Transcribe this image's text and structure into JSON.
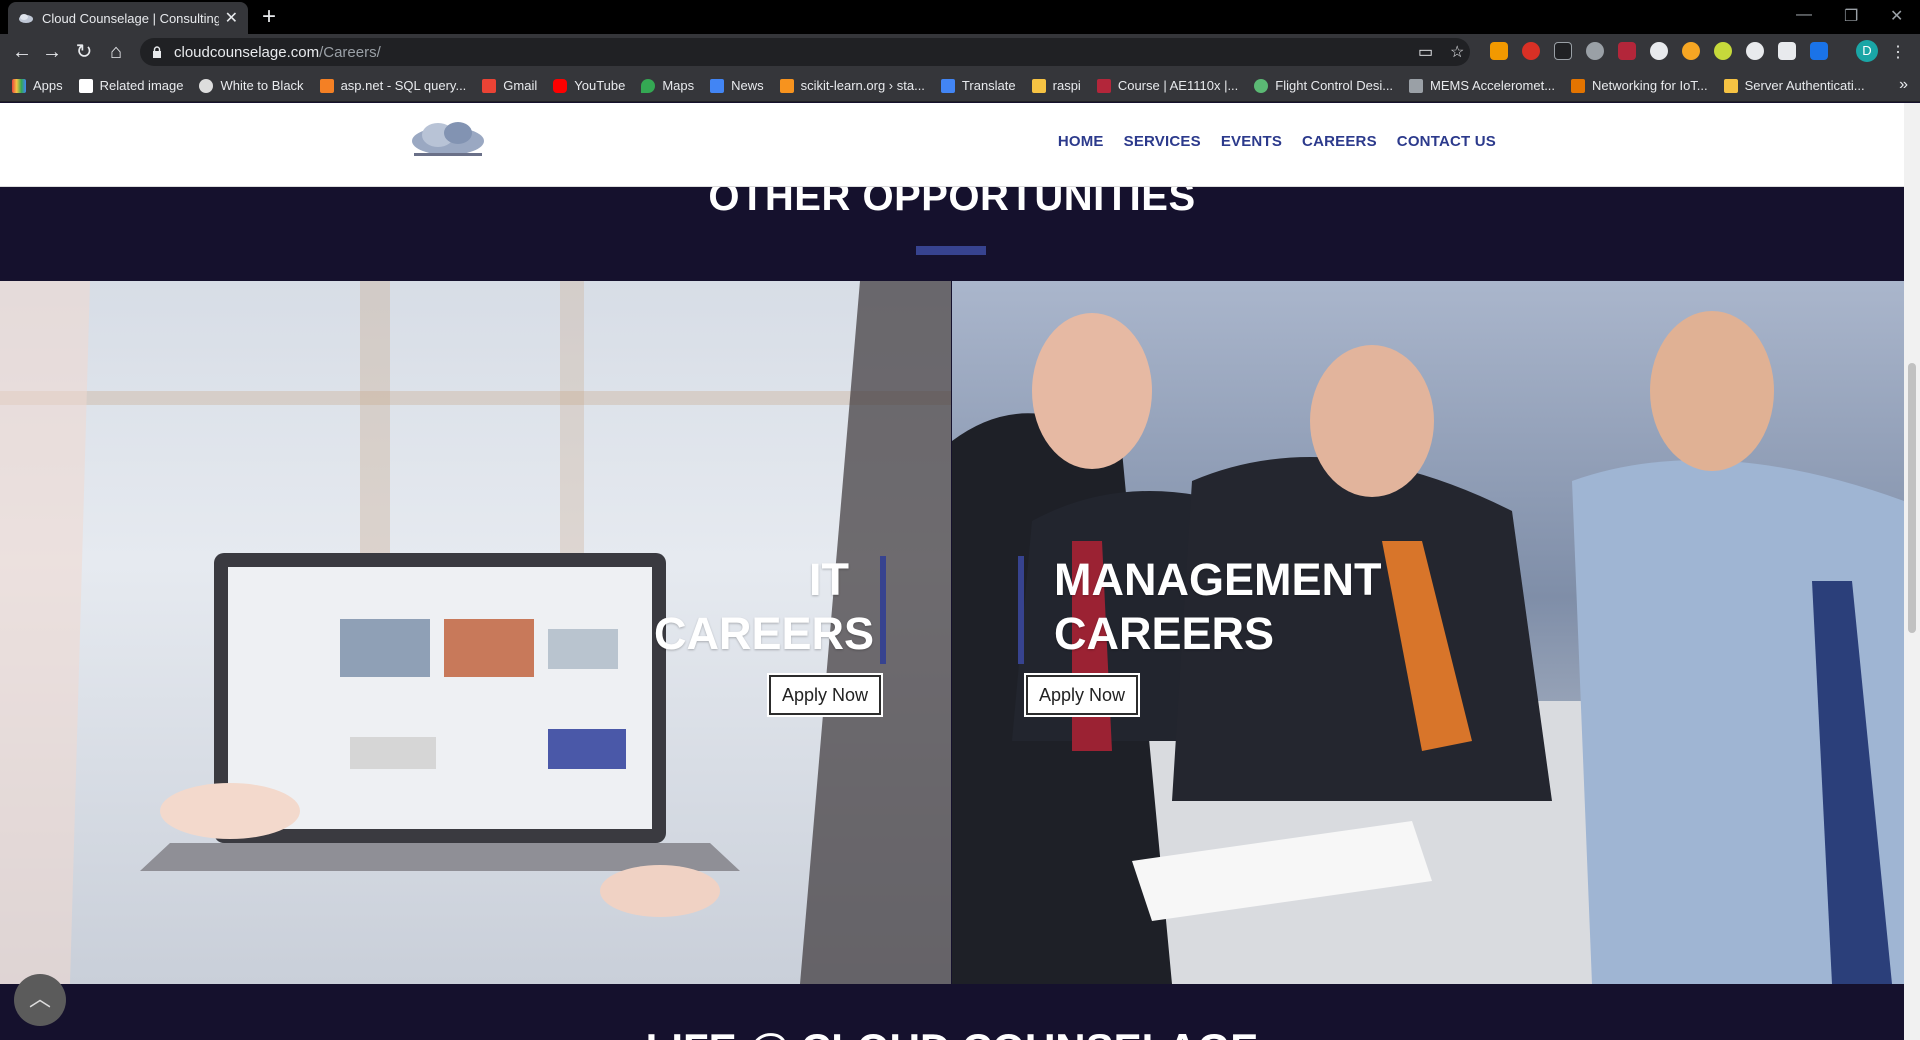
{
  "browser": {
    "tab_title": "Cloud Counselage | Consulting, /",
    "tab_close": "✕",
    "new_tab": "+",
    "url_host": "cloudcounselage.com",
    "url_path": "/Careers/",
    "profile_initial": "D",
    "window_controls": [
      "—",
      "❐",
      "✕"
    ]
  },
  "bookmarks": [
    {
      "label": "Apps",
      "color": "#e8453c"
    },
    {
      "label": "Related image",
      "color": "#ffffff"
    },
    {
      "label": "White to Black",
      "color": "#dddddd"
    },
    {
      "label": "asp.net - SQL query...",
      "color": "#f48024"
    },
    {
      "label": "Gmail",
      "color": "#ea4335"
    },
    {
      "label": "YouTube",
      "color": "#ff0000"
    },
    {
      "label": "Maps",
      "color": "#34a853"
    },
    {
      "label": "News",
      "color": "#4285f4"
    },
    {
      "label": "scikit-learn.org › sta...",
      "color": "#f7931e"
    },
    {
      "label": "Translate",
      "color": "#4285f4"
    },
    {
      "label": "raspi",
      "color": "#f6c343"
    },
    {
      "label": "Course | AE1110x |...",
      "color": "#b3263a"
    },
    {
      "label": "Flight Control Desi...",
      "color": "#5bb974"
    },
    {
      "label": "MEMS Acceleromet...",
      "color": "#9aa0a6"
    },
    {
      "label": "Networking for IoT...",
      "color": "#e37400"
    },
    {
      "label": "Server Authenticati...",
      "color": "#f6c343"
    }
  ],
  "bookmarks_more": "»",
  "site": {
    "nav": [
      "HOME",
      "SERVICES",
      "EVENTS",
      "CAREERS",
      "CONTACT US"
    ],
    "section_title": "OTHER OPPORTUNITIES",
    "it": {
      "line1": "IT",
      "line2": "CAREERS",
      "button": "Apply Now"
    },
    "management": {
      "line1": "MANAGEMENT",
      "line2": "CAREERS",
      "button": "Apply Now"
    },
    "lower_title": "LIFE @ CLOUD COUNSELAGE",
    "back_to_top": "︿"
  },
  "colors": {
    "brand_blue": "#2c3a8c",
    "accent_bar": "#37438f",
    "section_bg": "#15112d"
  }
}
